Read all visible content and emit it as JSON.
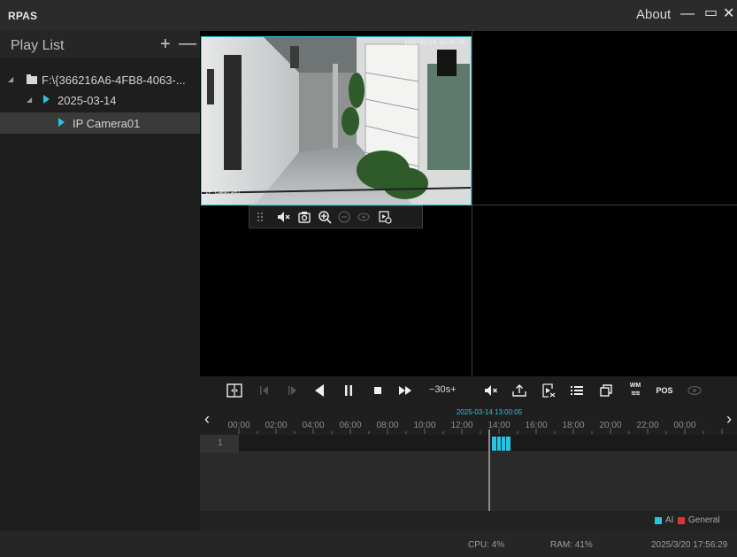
{
  "window": {
    "title": "RPAS",
    "about_label": "About",
    "minimize_glyph": "—",
    "maximize_glyph": "▭",
    "close_glyph": "✕"
  },
  "sidebar": {
    "title": "Play List",
    "add_glyph": "+",
    "remove_glyph": "—",
    "tree": [
      {
        "label": "F:\\{366216A6-4FB8-4063-...",
        "icon": "folder-icon",
        "level": 0
      },
      {
        "label": "2025-03-14",
        "icon": "play-icon",
        "level": 1
      },
      {
        "label": "IP Camera01",
        "icon": "play-icon",
        "level": 2,
        "selected": true
      }
    ]
  },
  "video": {
    "camera_timestamp": "2025/03/14 13:00:05",
    "camera_label": "IP Camera01",
    "pane_toolbar_icons": [
      "drag-handle-icon",
      "mute-icon",
      "snapshot-icon",
      "zoom-in-icon",
      "zoom-out-icon",
      "view-icon",
      "playback-export-icon"
    ]
  },
  "playback": {
    "speed_label": "−30s+",
    "buttons": [
      "layout-icon",
      "frame-back-icon",
      "frame-forward-icon",
      "reverse-play-icon",
      "pause-icon",
      "stop-icon",
      "fast-forward-icon",
      "speed-control",
      "mute-icon",
      "export-icon",
      "clip-icon",
      "list-icon",
      "window-icon",
      "watermark-icon",
      "pos-icon",
      "view-icon"
    ],
    "watermark_label": "WM",
    "pos_label": "POS"
  },
  "timeline": {
    "cursor_time": "2025-03-14 13:00:05",
    "ticks": [
      "00:00",
      "02:00",
      "04:00",
      "06:00",
      "08:00",
      "10:00",
      "12:00",
      "14:00",
      "16:00",
      "18:00",
      "20:00",
      "22:00",
      "00:00"
    ],
    "channel_number": "1",
    "record_range": {
      "start": "13:00",
      "end": "13:15"
    },
    "legend": [
      {
        "label": "AI",
        "color": "#25c4e0"
      },
      {
        "label": "General",
        "color": "#d9343a"
      }
    ]
  },
  "status": {
    "cpu": "CPU: 4%",
    "ram": "RAM: 41%",
    "datetime": "2025/3/20 17:56:29"
  },
  "colors": {
    "accent": "#25c4e0",
    "general": "#d9343a",
    "background": "#1e1e1e"
  }
}
